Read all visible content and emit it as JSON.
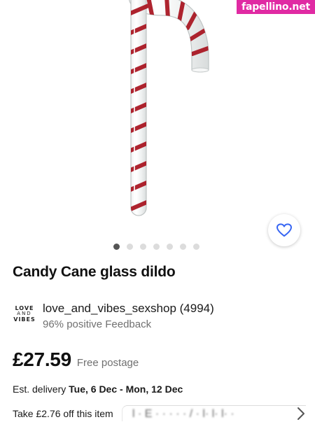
{
  "watermark": "fapellino.net",
  "gallery": {
    "image_icon": "candy-cane-product-image",
    "favorite_icon": "heart-outline-icon",
    "page_count": 7,
    "active_index": 0
  },
  "listing": {
    "title": "Candy Cane glass dildo"
  },
  "seller": {
    "logo_line1": "LOVE",
    "logo_line2": "AND",
    "logo_line3": "VIBES",
    "name": "love_and_vibes_sexshop (4994)",
    "feedback": "96% positive Feedback"
  },
  "price": {
    "amount": "£27.59",
    "postage": "Free postage"
  },
  "delivery": {
    "prefix": "Est. delivery",
    "dates": "Tue, 6 Dec - Mon, 12 Dec"
  },
  "offer": {
    "label": "Take £2.76 off this item",
    "overlay_text": "l · E · · · · · / · l· l· l· ·",
    "chevron_icon": "chevron-right-icon"
  },
  "colors": {
    "accent_blue": "#3665f3",
    "stripe_red": "#a8121e",
    "watermark_pink": "#e02aa3"
  }
}
